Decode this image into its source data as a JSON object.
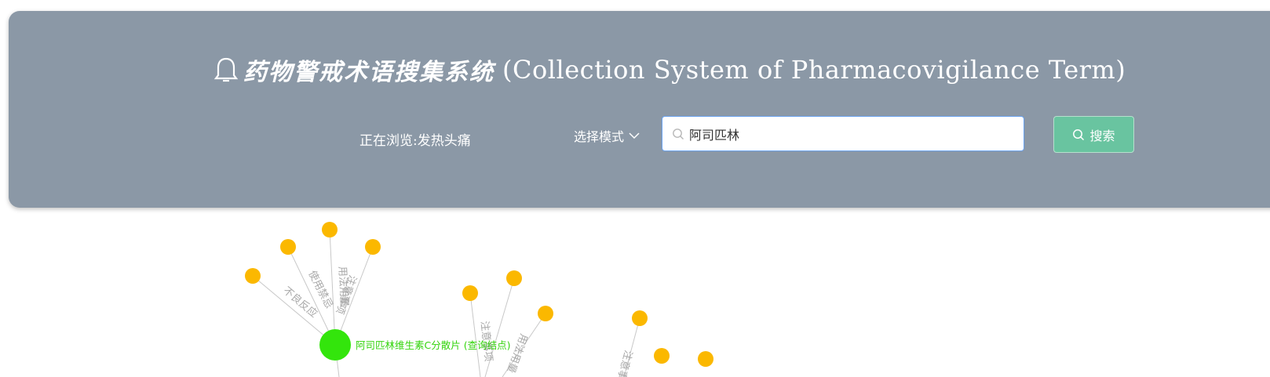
{
  "header": {
    "title_zh": "药物警戒术语搜集系统",
    "title_en": "(Collection System of Pharmacovigilance Term)",
    "browsing_label": "正在浏览:发热头痛",
    "mode_select_label": "选择模式",
    "search": {
      "value": "阿司匹林",
      "placeholder": ""
    },
    "search_button_label": "搜索"
  },
  "graph": {
    "query_node_label": "阿司匹林维生素C分散片 (查询结点)",
    "edge_labels": {
      "adverse_reaction": "不良反应",
      "contraindication": "使用禁忌",
      "dosage": "用法用量",
      "precautions": "注意事项",
      "precautions_2": "注意事项",
      "dosage_2": "用法用量",
      "precautions_3": "注意事项"
    }
  },
  "colors": {
    "header_bg": "#8b98a6",
    "search_button": "#69c4a0",
    "leaf_node": "#fbb800",
    "query_node": "#33e50c"
  }
}
